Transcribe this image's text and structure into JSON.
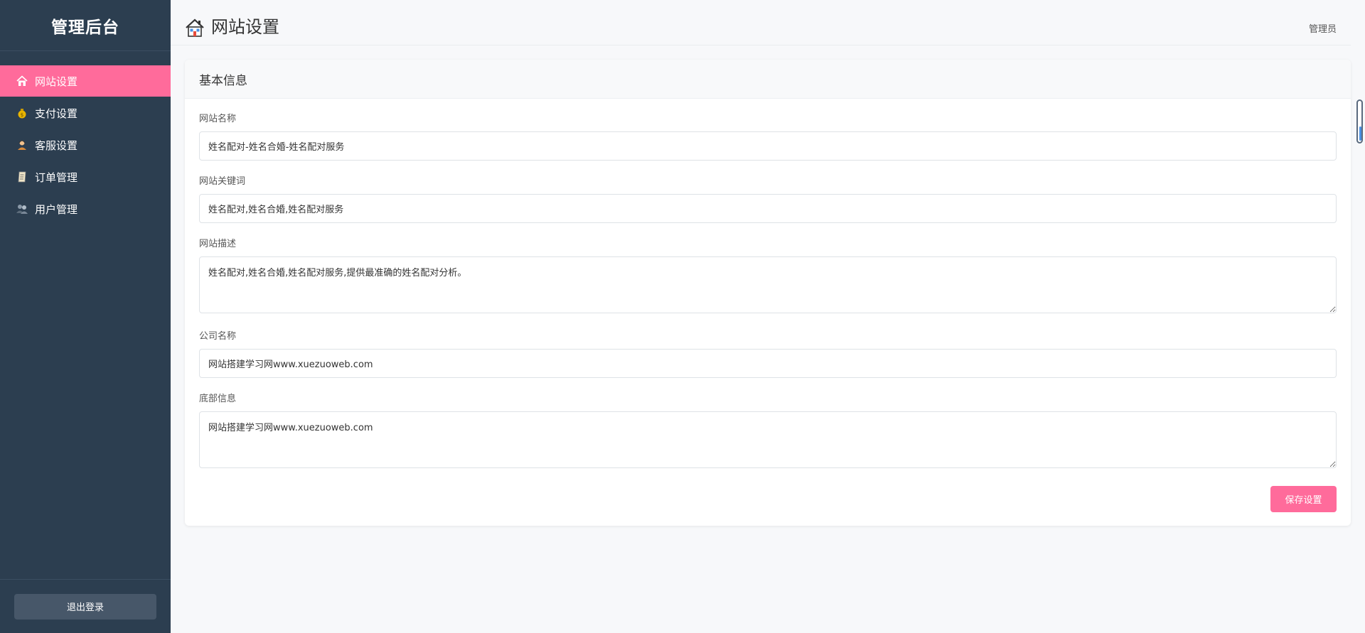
{
  "sidebar": {
    "brand": "管理后台",
    "items": [
      {
        "label": "网站设置",
        "icon": "house-icon",
        "active": true
      },
      {
        "label": "支付设置",
        "icon": "money-bag-icon",
        "active": false
      },
      {
        "label": "客服设置",
        "icon": "agent-icon",
        "active": false
      },
      {
        "label": "订单管理",
        "icon": "order-doc-icon",
        "active": false
      },
      {
        "label": "用户管理",
        "icon": "users-icon",
        "active": false
      }
    ],
    "logout_label": "退出登录"
  },
  "header": {
    "title": "网站设置",
    "title_icon": "house-icon",
    "user_label": "管理员"
  },
  "card": {
    "title": "基本信息",
    "fields": [
      {
        "label": "网站名称",
        "value": "姓名配对-姓名合婚-姓名配对服务",
        "type": "input"
      },
      {
        "label": "网站关键词",
        "value": "姓名配对,姓名合婚,姓名配对服务",
        "type": "input"
      },
      {
        "label": "网站描述",
        "value": "姓名配对,姓名合婚,姓名配对服务,提供最准确的姓名配对分析。",
        "type": "textarea"
      },
      {
        "label": "公司名称",
        "value": "网站搭建学习网www.xuezuoweb.com",
        "type": "input"
      },
      {
        "label": "底部信息",
        "value": "网站搭建学习网www.xuezuoweb.com",
        "type": "textarea"
      }
    ],
    "save_label": "保存设置"
  },
  "colors": {
    "sidebar_bg": "#2c3e50",
    "accent": "#ff6b9b",
    "page_bg": "#f7f8fa"
  }
}
